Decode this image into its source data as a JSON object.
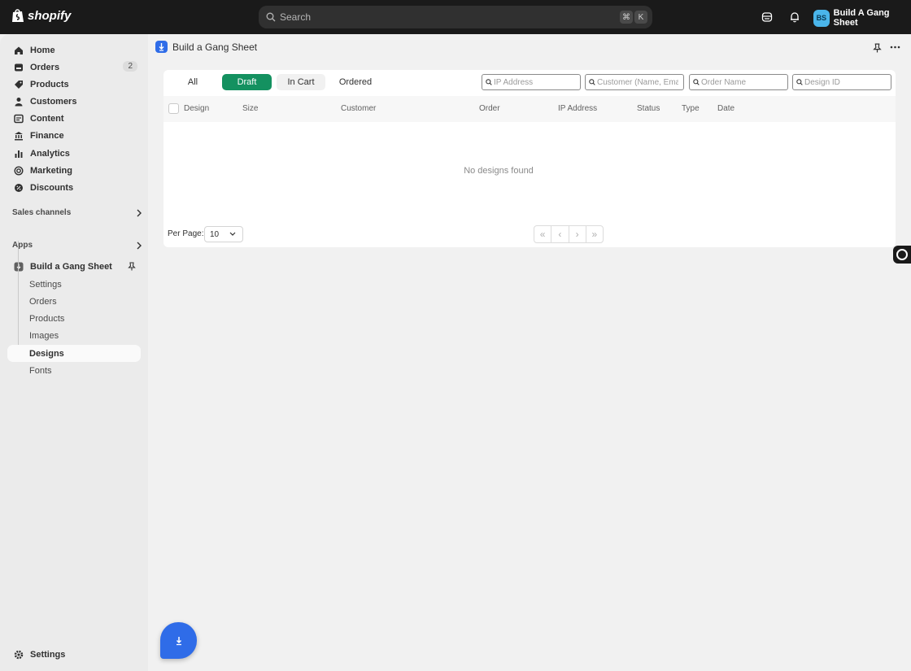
{
  "topbar": {
    "logo_text": "shopify",
    "search_placeholder": "Search",
    "shortcut_keys": [
      "⌘",
      "K"
    ],
    "user_initials": "BS",
    "user_name": "Build A Gang Sheet"
  },
  "sidebar": {
    "items": [
      {
        "label": "Home",
        "icon": "home-icon"
      },
      {
        "label": "Orders",
        "icon": "orders-icon",
        "badge": "2"
      },
      {
        "label": "Products",
        "icon": "tag-icon"
      },
      {
        "label": "Customers",
        "icon": "person-icon"
      },
      {
        "label": "Content",
        "icon": "content-icon"
      },
      {
        "label": "Finance",
        "icon": "bank-icon"
      },
      {
        "label": "Analytics",
        "icon": "bar-chart-icon"
      },
      {
        "label": "Marketing",
        "icon": "target-icon"
      },
      {
        "label": "Discounts",
        "icon": "discount-icon"
      }
    ],
    "sales_channels_label": "Sales channels",
    "apps_label": "Apps",
    "app_name": "Build a Gang Sheet",
    "app_sub_items": [
      "Settings",
      "Orders",
      "Products",
      "Images",
      "Designs",
      "Fonts"
    ],
    "active_sub_item": "Designs",
    "settings_label": "Settings"
  },
  "header": {
    "title": "Build a Gang Sheet"
  },
  "tabs": [
    {
      "label": "All",
      "active": false
    },
    {
      "label": "Draft",
      "active": true
    },
    {
      "label": "In Cart",
      "active": false
    },
    {
      "label": "Ordered",
      "active": false
    }
  ],
  "filters": {
    "ip_placeholder": "IP Address",
    "customer_placeholder": "Customer (Name, Email)",
    "order_placeholder": "Order Name",
    "design_placeholder": "Design ID"
  },
  "table": {
    "columns": [
      "Design",
      "Size",
      "Customer",
      "Order",
      "IP Address",
      "Status",
      "Type",
      "Date"
    ],
    "empty_message": "No designs found"
  },
  "pagination": {
    "per_page_label": "Per Page:",
    "per_page_value": "10",
    "buttons": [
      "«",
      "‹",
      "›",
      "»"
    ]
  },
  "colors": {
    "accent": "#149160",
    "topbar": "#1a1a1a",
    "app_blue": "#2f6ce8"
  }
}
